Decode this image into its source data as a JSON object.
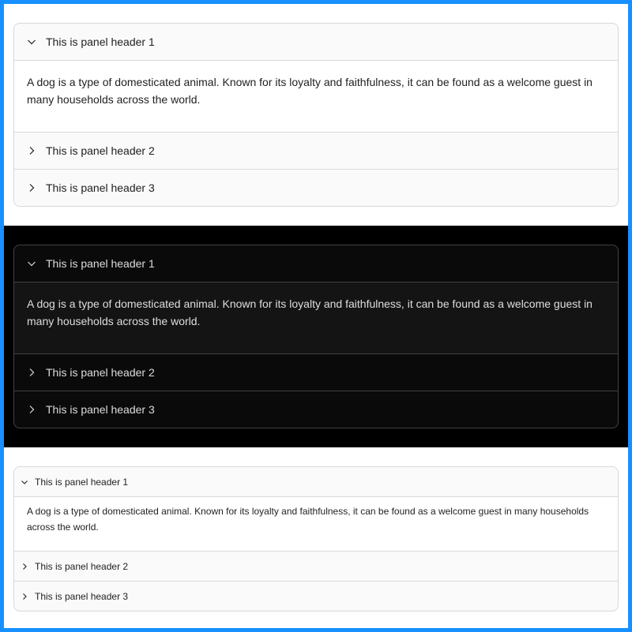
{
  "colors": {
    "outer_border": "#1890ff",
    "light_bg": "#ffffff",
    "dark_bg": "#000000",
    "panel_header_light": "#fafafa",
    "panel_header_dark": "#0a0a0a",
    "content_dark": "#141414"
  },
  "sections": [
    {
      "theme": "light",
      "size": "large",
      "panels": [
        {
          "header": "This is panel header 1",
          "expanded": true,
          "icon": "chevron-down-icon",
          "content": "A dog is a type of domesticated animal. Known for its loyalty and faithfulness, it can be found as a welcome guest in many households across the world."
        },
        {
          "header": "This is panel header 2",
          "expanded": false,
          "icon": "chevron-right-icon"
        },
        {
          "header": "This is panel header 3",
          "expanded": false,
          "icon": "chevron-right-icon"
        }
      ]
    },
    {
      "theme": "dark",
      "size": "large",
      "panels": [
        {
          "header": "This is panel header 1",
          "expanded": true,
          "icon": "chevron-down-icon",
          "content": "A dog is a type of domesticated animal. Known for its loyalty and faithfulness, it can be found as a welcome guest in many households across the world."
        },
        {
          "header": "This is panel header 2",
          "expanded": false,
          "icon": "chevron-right-icon"
        },
        {
          "header": "This is panel header 3",
          "expanded": false,
          "icon": "chevron-right-icon"
        }
      ]
    },
    {
      "theme": "light",
      "size": "small",
      "panels": [
        {
          "header": "This is panel header 1",
          "expanded": true,
          "icon": "chevron-down-icon",
          "content": "A dog is a type of domesticated animal. Known for its loyalty and faithfulness, it can be found as a welcome guest in many households across the world."
        },
        {
          "header": "This is panel header 2",
          "expanded": false,
          "icon": "chevron-right-icon"
        },
        {
          "header": "This is panel header 3",
          "expanded": false,
          "icon": "chevron-right-icon"
        }
      ]
    }
  ]
}
